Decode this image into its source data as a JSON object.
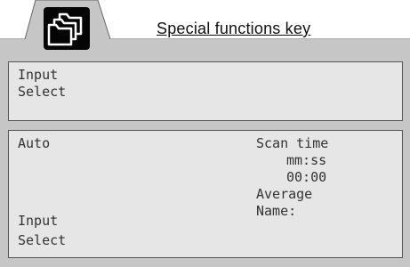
{
  "header": {
    "title": "Special functions key",
    "icon": "folders-icon"
  },
  "panel_top": {
    "lines": [
      "Input",
      "Select"
    ]
  },
  "panel_main": {
    "left_top": "Auto",
    "left_bottom": [
      "Input",
      "Select"
    ],
    "right": {
      "scan_label": "Scan time",
      "time_format": "mm:ss",
      "time_value": "00:00",
      "average_label": "Average",
      "name_label": "Name:"
    }
  },
  "colors": {
    "background": "#c6c6c6",
    "panel": "#e6e6e6",
    "icon_key": "#050505"
  }
}
